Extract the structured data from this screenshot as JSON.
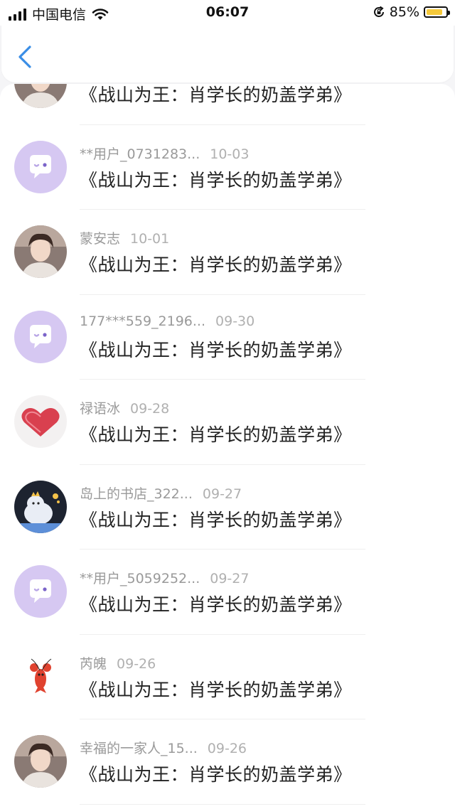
{
  "status_bar": {
    "carrier": "中国电信",
    "time": "06:07",
    "battery_percent": "85%",
    "battery_level": 0.85,
    "icons": [
      "signal-icon",
      "wifi-icon",
      "orientation-lock-icon",
      "battery-icon"
    ]
  },
  "nav": {
    "back_icon": "chevron-left-icon"
  },
  "colors": {
    "accent": "#3a8ee6",
    "default_avatar_bg": "#d6c8f2",
    "battery_fill": "#f5c93a"
  },
  "items": [
    {
      "user": "",
      "date": "",
      "title": "《战山为王：肖学长的奶盖学弟》",
      "avatar": "photo-avatar"
    },
    {
      "user": "**用户_0731283...",
      "date": "10-03",
      "title": "《战山为王：肖学长的奶盖学弟》",
      "avatar": "default-chat-avatar"
    },
    {
      "user": "蒙安志",
      "date": "10-01",
      "title": "《战山为王：肖学长的奶盖学弟》",
      "avatar": "photo-avatar"
    },
    {
      "user": "177***559_2196...",
      "date": "09-30",
      "title": "《战山为王：肖学长的奶盖学弟》",
      "avatar": "default-chat-avatar"
    },
    {
      "user": "禄语冰",
      "date": "09-28",
      "title": "《战山为王：肖学长的奶盖学弟》",
      "avatar": "heart-avatar"
    },
    {
      "user": "岛上的书店_322...",
      "date": "09-27",
      "title": "《战山为王：肖学长的奶盖学弟》",
      "avatar": "cartoon-avatar"
    },
    {
      "user": "**用户_5059252...",
      "date": "09-27",
      "title": "《战山为王：肖学长的奶盖学弟》",
      "avatar": "default-chat-avatar"
    },
    {
      "user": "芮魄",
      "date": "09-26",
      "title": "《战山为王：肖学长的奶盖学弟》",
      "avatar": "lobster-avatar"
    },
    {
      "user": "幸福的一家人_15...",
      "date": "09-26",
      "title": "《战山为王：肖学长的奶盖学弟》",
      "avatar": "photo-avatar"
    }
  ]
}
